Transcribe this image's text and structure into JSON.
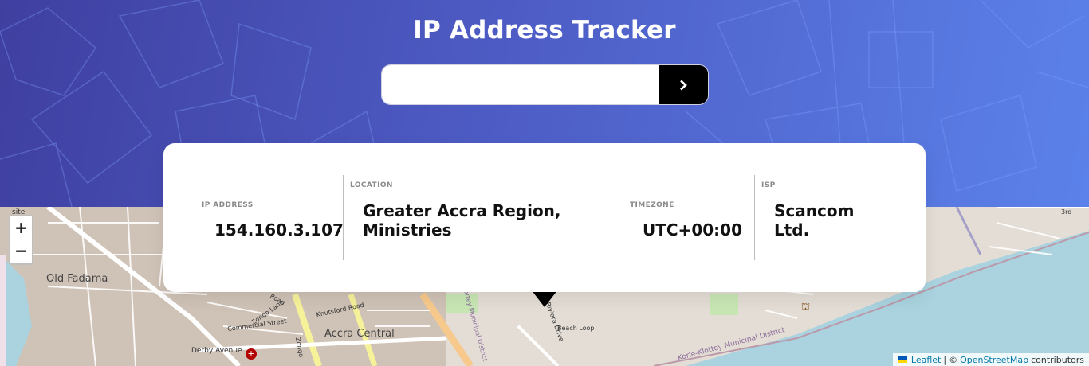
{
  "header": {
    "title": "IP Address Tracker",
    "search": {
      "value": "",
      "placeholder": ""
    },
    "submit_icon": "chevron-right-icon"
  },
  "info": {
    "ip": {
      "label": "IP ADDRESS",
      "value": "154.160.3.107"
    },
    "location": {
      "label": "LOCATION",
      "value_line1": "Greater Accra Region,",
      "value_line2": "Ministries"
    },
    "timezone": {
      "label": "TIMEZONE",
      "value": "UTC+00:00"
    },
    "isp": {
      "label": "ISP",
      "value_line1": "Scancom",
      "value_line2": "Ltd."
    }
  },
  "map": {
    "zoom_in": "+",
    "zoom_out": "−",
    "labels": {
      "old_fadama": "Old Fadama",
      "accra_central": "Accra Central",
      "site": "site",
      "derby_avenue": "Derby Avenue",
      "commercial_street": "Commercial Street",
      "knutsford_road": "Knutsford Road",
      "zongo_lane": "Zongo Lane",
      "beach_loop": "Beach Loop",
      "riviera_drive": "Riviera Drive",
      "district": "Korle-Klottey Municipal District",
      "municipal": "Korle-Klottey Municipal District",
      "third": "3rd",
      "road": "Road",
      "zongo": "Zongo"
    },
    "attribution": {
      "leaflet": "Leaflet",
      "separator": "|",
      "copyright": "©",
      "osm": "OpenStreetMap",
      "contributors": "contributors"
    }
  },
  "colors": {
    "header_start": "#3f3fa0",
    "header_end": "#5b82ea",
    "button": "#000000",
    "sea": "#aad3df",
    "land": "#e9e4dc"
  }
}
